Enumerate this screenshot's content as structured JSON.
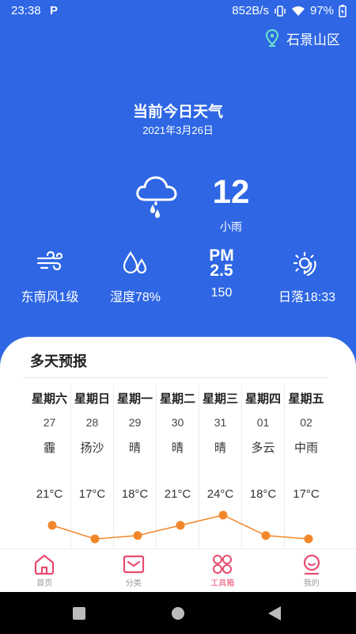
{
  "status": {
    "time": "23:38",
    "app_icon": "P",
    "speed": "852B/s",
    "battery": "97%"
  },
  "location": {
    "name": "石景山区"
  },
  "header": {
    "title": "当前今日天气",
    "date": "2021年3月26日"
  },
  "current": {
    "temp": "12",
    "condition": "小雨",
    "icon": "cloud-rain-icon"
  },
  "stats": {
    "wind": "东南风1级",
    "humidity": "湿度78%",
    "pm_top": "PM",
    "pm_bottom": "2.5",
    "pm_value": "150",
    "sunset": "日落18:33"
  },
  "forecast": {
    "title": "多天预报",
    "days": [
      {
        "weekday": "星期六",
        "date": "27",
        "weather": "霾",
        "temp": "21°C"
      },
      {
        "weekday": "星期日",
        "date": "28",
        "weather": "扬沙",
        "temp": "17°C"
      },
      {
        "weekday": "星期一",
        "date": "29",
        "weather": "晴",
        "temp": "18°C"
      },
      {
        "weekday": "星期二",
        "date": "30",
        "weather": "晴",
        "temp": "21°C"
      },
      {
        "weekday": "星期三",
        "date": "31",
        "weather": "晴",
        "temp": "24°C"
      },
      {
        "weekday": "星期四",
        "date": "01",
        "weather": "多云",
        "temp": "18°C"
      },
      {
        "weekday": "星期五",
        "date": "02",
        "weather": "中雨",
        "temp": "17°C"
      }
    ],
    "line_temps": [
      21,
      17,
      18,
      21,
      24,
      18,
      17
    ],
    "line_color": "#F2862A"
  },
  "nav": {
    "items": [
      {
        "label": "首页",
        "icon": "home-icon"
      },
      {
        "label": "分类",
        "icon": "mail-icon"
      },
      {
        "label": "工具箱",
        "icon": "toolbox-icon",
        "active": true
      },
      {
        "label": "我的",
        "icon": "profile-icon"
      }
    ]
  },
  "colors": {
    "primary_blue": "#2E66E4",
    "accent_pink": "#E84B6E"
  }
}
